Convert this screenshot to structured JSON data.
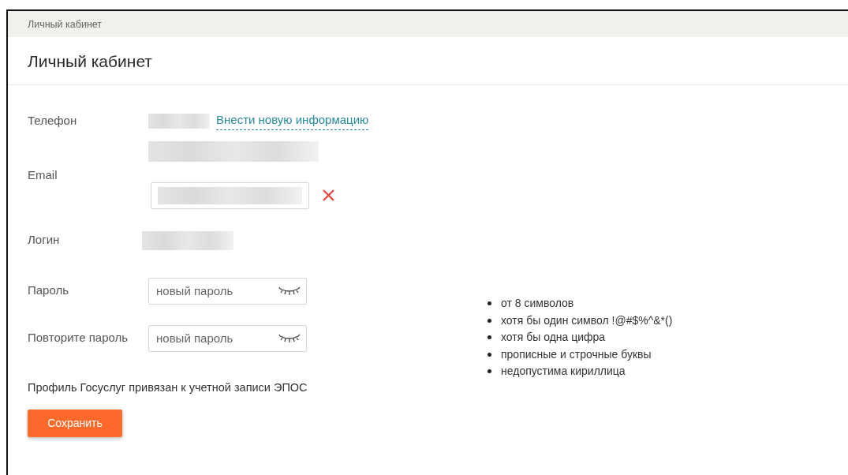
{
  "breadcrumb": "Личный кабинет",
  "title": "Личный кабинет",
  "phone": {
    "label": "Телефон",
    "link": "Внести новую информацию"
  },
  "email": {
    "label": "Email"
  },
  "login": {
    "label": "Логин"
  },
  "password": {
    "label": "Пароль",
    "placeholder": "новый пароль"
  },
  "password_repeat": {
    "label": "Повторите пароль",
    "placeholder": "новый пароль"
  },
  "password_rules": [
    "от 8 символов",
    "хотя бы один символ !@#$%^&*()",
    "хотя бы одна цифра",
    "прописные и строчные буквы",
    "недопустима кириллица"
  ],
  "note": "Профиль Госуслуг привязан к учетной записи ЭПОС",
  "save_button": "Сохранить"
}
